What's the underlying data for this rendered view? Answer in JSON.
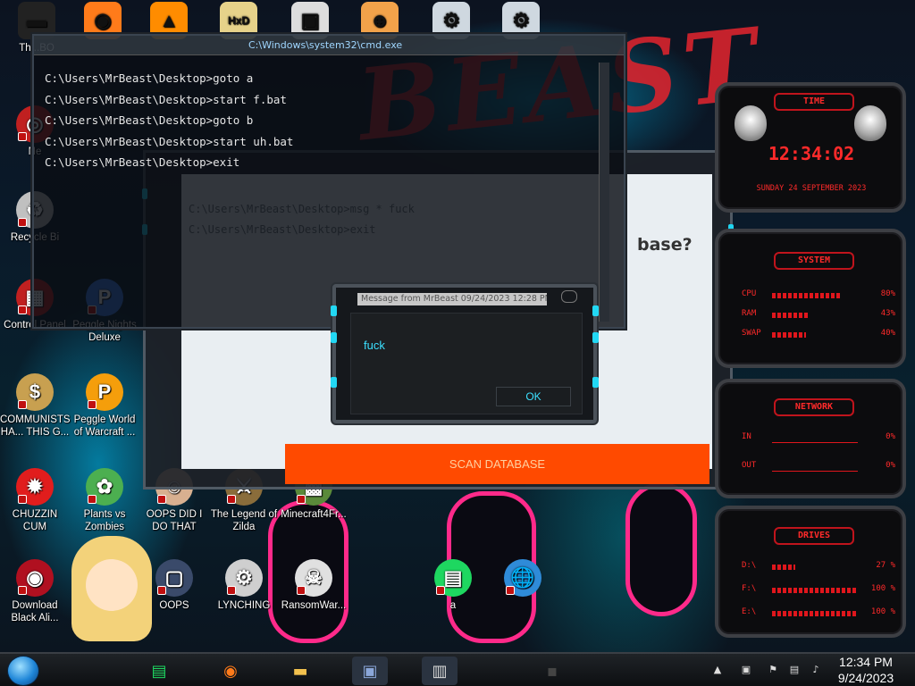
{
  "wallpaper": {
    "word": "BEAST"
  },
  "top_icons": [
    {
      "name": "top-icon-tb",
      "label": "Th...BO",
      "glyph": "▬",
      "color": "#222"
    },
    {
      "name": "top-icon-firefox",
      "label": "",
      "glyph": "◉",
      "color": "#ff7b1a"
    },
    {
      "name": "top-icon-vlc",
      "label": "",
      "glyph": "▲",
      "color": "#ff8c00"
    },
    {
      "name": "top-icon-hxd",
      "label": "",
      "glyph": "HxD",
      "color": "#e6d28a"
    },
    {
      "name": "top-icon-app",
      "label": "",
      "glyph": "▣",
      "color": "#ddd"
    },
    {
      "name": "top-icon-user",
      "label": "",
      "glyph": "☻",
      "color": "#f2a24a"
    },
    {
      "name": "top-icon-gear1",
      "label": "",
      "glyph": "⚙",
      "color": "#cfd8e0"
    },
    {
      "name": "top-icon-gear2",
      "label": "",
      "glyph": "⚙",
      "color": "#cfd8e0"
    }
  ],
  "left_icons": [
    {
      "name": "icon-network",
      "label": "Ne",
      "glyph": "◎",
      "color": "#c02020"
    },
    {
      "name": "icon-recycle",
      "label": "Recycle Bi",
      "glyph": "♻",
      "color": "#c0c0c0"
    },
    {
      "name": "icon-control-panel",
      "label": "Control Panel",
      "glyph": "▦",
      "color": "#c02020"
    },
    {
      "name": "icon-peggle-nights",
      "label": "Peggle Nights Deluxe",
      "glyph": "P",
      "color": "#3b82f6"
    },
    {
      "name": "icon-communists",
      "label": "COMMUNISTS HA... THIS G...",
      "glyph": "$",
      "color": "#c8a050"
    },
    {
      "name": "icon-peggle-wow",
      "label": "Peggle World of Warcraft ...",
      "glyph": "P",
      "color": "#f59e0b"
    },
    {
      "name": "icon-chuzzin",
      "label": "CHUZZIN CUM",
      "glyph": "✹",
      "color": "#e11d1d"
    },
    {
      "name": "icon-pvz",
      "label": "Plants vs Zombies",
      "glyph": "✿",
      "color": "#4caf50"
    },
    {
      "name": "icon-oops-did",
      "label": "OOPS DID I DO THAT",
      "glyph": "☺",
      "color": "#d8b090"
    },
    {
      "name": "icon-zelda",
      "label": "The Legend of Zilda",
      "glyph": "⚔",
      "color": "#8a6d3b"
    },
    {
      "name": "icon-minecraft",
      "label": "Minecraft4Fr...",
      "glyph": "▩",
      "color": "#5a8a3a"
    },
    {
      "name": "icon-download-alien",
      "label": "Download Black Ali...",
      "glyph": "◉",
      "color": "#b01020"
    },
    {
      "name": "icon-oops",
      "label": "OOPS",
      "glyph": "▢",
      "color": "#3a4a6a"
    },
    {
      "name": "icon-lynching",
      "label": "LYNCHING",
      "glyph": "⚙",
      "color": "#cfcfcf"
    },
    {
      "name": "icon-ransomware",
      "label": "RansomWar...",
      "glyph": "☠",
      "color": "#e0e0e0"
    },
    {
      "name": "icon-a",
      "label": "a",
      "glyph": "▤",
      "color": "#1ed760"
    },
    {
      "name": "icon-globe",
      "label": "",
      "glyph": "🌐",
      "color": "#2f8bd8"
    }
  ],
  "cmd": {
    "title": "C:\\Windows\\system32\\cmd.exe",
    "lines": [
      "C:\\Users\\MrBeast\\Desktop>goto a",
      "C:\\Users\\MrBeast\\Desktop>start f.bat",
      "C:\\Users\\MrBeast\\Desktop>goto b",
      "C:\\Users\\MrBeast\\Desktop>start uh.bat",
      "C:\\Users\\MrBeast\\Desktop>exit"
    ]
  },
  "scanner": {
    "cmd_lines": [
      "C:\\Users\\MrBeast\\Desktop>msg * fuck",
      "C:\\Users\\MrBeast\\Desktop>exit"
    ],
    "question": "base?",
    "button": "SCAN DATABASE"
  },
  "msgbox": {
    "title": "Message from MrBeast 09/24/2023 12:28 PM",
    "text": "fuck",
    "ok": "OK"
  },
  "gadgets": {
    "time": {
      "title": "TIME",
      "clock": "12:34:02",
      "date": "SUNDAY 24 SEPTEMBER 2023"
    },
    "system": {
      "title": "SYSTEM",
      "rows": [
        {
          "label": "CPU",
          "value": "80%",
          "fill": 0.8
        },
        {
          "label": "RAM",
          "value": "43%",
          "fill": 0.43
        },
        {
          "label": "SWAP",
          "value": "40%",
          "fill": 0.4
        }
      ]
    },
    "network": {
      "title": "NETWORK",
      "rows": [
        {
          "label": "IN",
          "value": "0%"
        },
        {
          "label": "OUT",
          "value": "0%"
        }
      ]
    },
    "drives": {
      "title": "DRIVES",
      "rows": [
        {
          "label": "D:\\",
          "value": "27 %",
          "fill": 0.27
        },
        {
          "label": "F:\\",
          "value": "100 %",
          "fill": 1.0
        },
        {
          "label": "E:\\",
          "value": "100 %",
          "fill": 1.0
        }
      ]
    }
  },
  "taskbar": {
    "apps": [
      {
        "name": "taskbar-spotify",
        "glyph": "▤",
        "color": "#1ed760"
      },
      {
        "name": "taskbar-firefox",
        "glyph": "◉",
        "color": "#ff7b1a"
      },
      {
        "name": "taskbar-explorer",
        "glyph": "▬",
        "color": "#f2c14e"
      },
      {
        "name": "taskbar-window1",
        "glyph": "▣",
        "color": "#8aa6d8"
      },
      {
        "name": "taskbar-window2",
        "glyph": "▥",
        "color": "#d8d8d8"
      },
      {
        "name": "taskbar-cmd",
        "glyph": "▪",
        "color": "#444"
      }
    ],
    "clock_time": "12:34 PM",
    "clock_date": "9/24/2023"
  }
}
